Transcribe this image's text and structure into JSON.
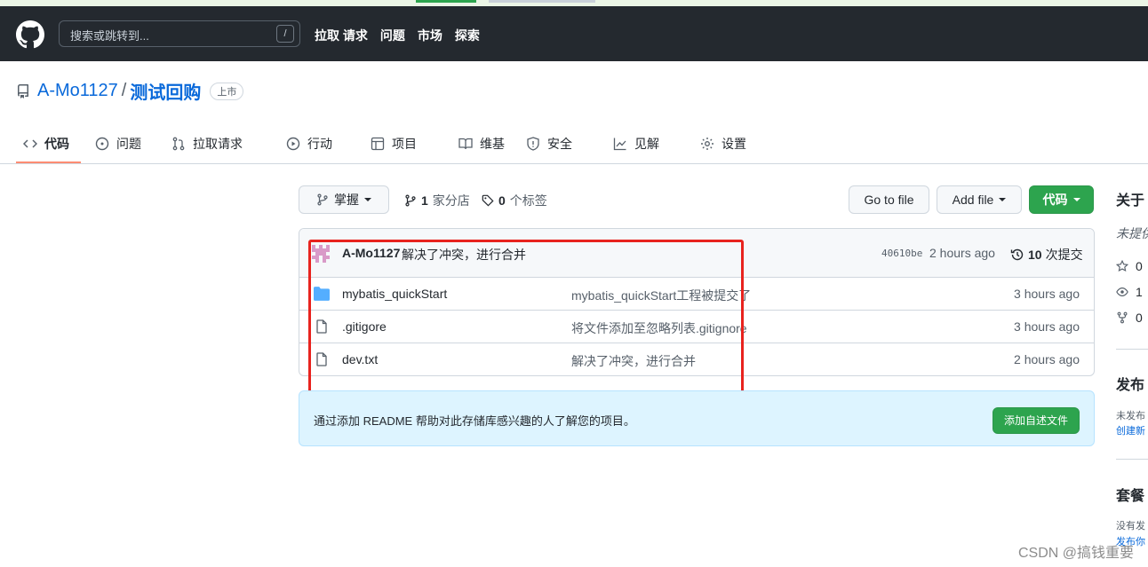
{
  "header": {
    "search_placeholder": "搜索或跳转到...",
    "search_shortcut": "/",
    "nav": [
      "拉取 请求",
      "问题",
      "市场",
      "探索"
    ]
  },
  "repo": {
    "owner": "A-Mo1127",
    "separator": "/",
    "name": "测试回购",
    "visibility": "上市"
  },
  "tabs": [
    {
      "label": "代码",
      "icon": "code-icon"
    },
    {
      "label": "问题",
      "icon": "issue-icon"
    },
    {
      "label": "拉取请求",
      "icon": "pull-request-icon"
    },
    {
      "label": "行动",
      "icon": "play-icon"
    },
    {
      "label": "项目",
      "icon": "table-icon"
    },
    {
      "label": "维基",
      "icon": "book-icon"
    },
    {
      "label": "安全",
      "icon": "shield-icon"
    },
    {
      "label": "见解",
      "icon": "graph-icon"
    },
    {
      "label": "设置",
      "icon": "gear-icon"
    }
  ],
  "toolbar": {
    "branch": "掌握",
    "branches_count": "1",
    "branches_label": "家分店",
    "tags_count": "0",
    "tags_label": "个标签",
    "go_to_file": "Go to file",
    "add_file": "Add file",
    "code": "代码"
  },
  "latest_commit": {
    "author": "A-Mo1127",
    "message": "解决了冲突，进行合并",
    "hash": "40610be",
    "time": "2 hours ago",
    "count": "10",
    "count_label": "次提交"
  },
  "files": [
    {
      "name": "mybatis_quickStart",
      "type": "folder",
      "message": "mybatis_quickStart工程被提交了",
      "time": "3 hours ago"
    },
    {
      "name": ".gitigore",
      "type": "file",
      "message": "将文件添加至忽略列表.gitignore",
      "time": "3 hours ago"
    },
    {
      "name": "dev.txt",
      "type": "file",
      "message": "解决了冲突，进行合并",
      "time": "2 hours ago"
    }
  ],
  "readme_banner": {
    "text": "通过添加 README 帮助对此存储库感兴趣的人了解您的项目。",
    "button": "添加自述文件"
  },
  "sidebar": {
    "about_heading": "关于",
    "about_desc": "未提供描述",
    "stars": "0",
    "watchers": "1",
    "forks": "0",
    "releases_heading": "发布",
    "releases_text": "未发布",
    "releases_link": "创建新",
    "packages_heading": "套餐",
    "packages_text": "没有发",
    "packages_link": "发布你"
  },
  "watermark": "CSDN @搞钱重要",
  "colors": {
    "header_bg": "#24292f",
    "link": "#0969da",
    "primary_button": "#2da44e",
    "tab_underline": "#fd8c73",
    "annotation_red": "#e8231e",
    "banner_bg": "#ddf4ff"
  }
}
